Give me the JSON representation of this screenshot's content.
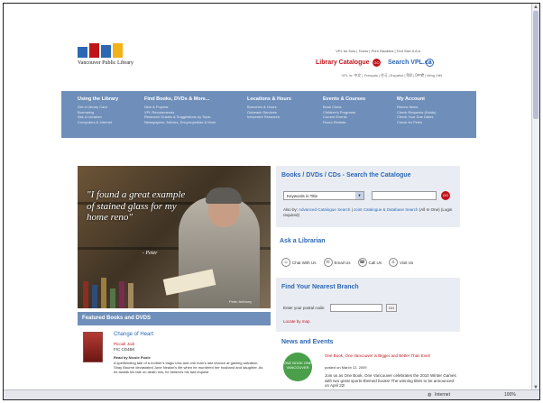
{
  "header": {
    "logo_name": "Vancouver Public Library",
    "utility_links": "VPL for Kids | Teens | Print Disabled | Text Size A A A",
    "catalogue_label": "Library Catalogue",
    "catalogue_go": "GO",
    "search_vpl_label": "Search VPL.ca",
    "language_bar": "VPL in: 中文 | Français | 한국 | Español | हिंदी | ਪੰਜਾਬੀ | tiếng Việt"
  },
  "nav": {
    "columns": [
      {
        "heading": "Using the Library",
        "items": [
          "Get a Library Card",
          "Borrowing",
          "Ask a Librarian",
          "Computers & Internet"
        ]
      },
      {
        "heading": "Find Books, DVDs & More...",
        "items": [
          "New & Popular",
          "VPL Recommends",
          "Research Guides & Suggestions by Topic",
          "Newspapers, Articles, Encyclopedias & More"
        ]
      },
      {
        "heading": "Locations & Hours",
        "items": [
          "Branches & Hours",
          "Outreach Services",
          "Infocentre Research"
        ]
      },
      {
        "heading": "Events & Courses",
        "items": [
          "Book Clubs",
          "Children's Programs",
          "Current Events",
          "Room Rentals"
        ]
      },
      {
        "heading": "My Account",
        "items": [
          "Renew Items",
          "Check Requests (Holds)",
          "Check Your Due Dates",
          "Check for Fines"
        ]
      }
    ]
  },
  "hero": {
    "quote": "\"I found a great example of stained glass for my home reno\"",
    "author": "- Peter",
    "credit": "Peter Anthony"
  },
  "featured": {
    "heading": "Featured Books and DVDS",
    "book_title": "Change of Heart",
    "book_author": "Picoult Jodi",
    "book_code": "FIC CD4BK",
    "read_by": "Read by Nicole Poole",
    "description": "A spellbinding tale of a mother's tragic loss and one man's last chance at gaining salvation. Shay Bourne devastated June Nealon's life when he murdered her husband and daughter. As he awaits his fate on death row, he believes his last request"
  },
  "catalogue_search": {
    "title": "Books / DVDs / CDs - Search the Catalogue",
    "search_type": "Keywords in Title",
    "go": "GO",
    "also_by": "Also by:",
    "advanced_link": "Advanced Catalogue Search",
    "joint_link": "Joint Catalogue & Database Search",
    "also_note": "(All In One) (Login required)"
  },
  "ask": {
    "title": "Ask a Librarian",
    "options": [
      "Chat With Us",
      "Email Us",
      "Call Us",
      "Visit Us"
    ]
  },
  "branch": {
    "title": "Find Your Nearest Branch",
    "postal_label": "Enter your postal code:",
    "go": "GO",
    "locate": "Locate by map"
  },
  "news": {
    "title": "News and Events",
    "logo_text": "ONE BOOK ONE VANCOUVER",
    "item1_title": "One Book, One Vancouver is Bigger and Better Than Ever!",
    "item1_date": "posted on March 12, 2009",
    "item2_text": "Join us as One Book, One Vancouver celebrates the 2010 Winter Games with two great sports-themed books! The winning titles to be announced on April 22!"
  },
  "statusbar": {
    "zone": "Internet",
    "zoom": "100%"
  },
  "colors": {
    "nav_blue": "#6f8fba",
    "link_blue": "#2c67b4",
    "brand_red": "#c0141b",
    "panel_bg": "#e9edf3"
  }
}
